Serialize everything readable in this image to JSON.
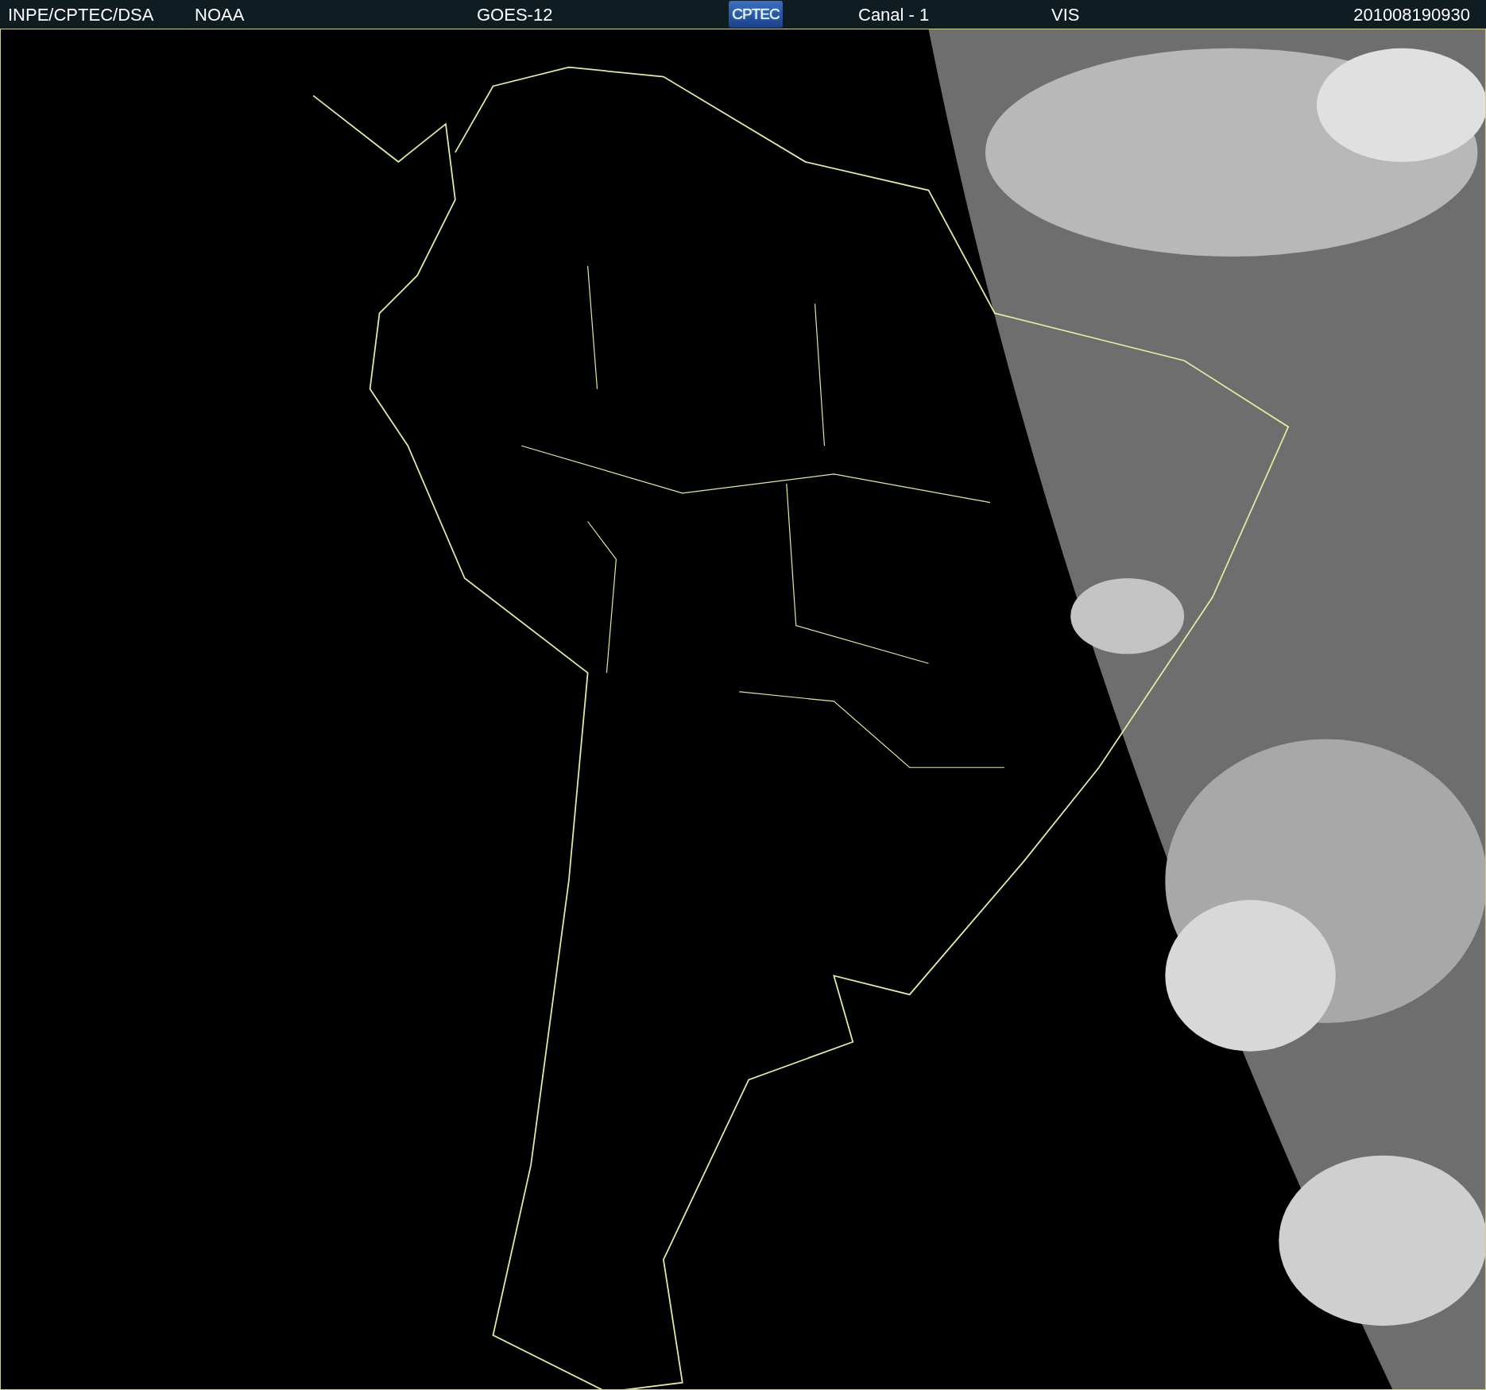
{
  "header": {
    "items": [
      {
        "kind": "text",
        "text": "INPE/CPTEC/DSA"
      },
      {
        "kind": "text",
        "text": "NOAA"
      },
      {
        "kind": "text",
        "text": "GOES-12"
      },
      {
        "kind": "logo",
        "text": "CPTEC"
      },
      {
        "kind": "text",
        "text": "Canal - 1"
      },
      {
        "kind": "text",
        "text": "VIS"
      },
      {
        "kind": "text",
        "text": "201008190930"
      }
    ]
  }
}
